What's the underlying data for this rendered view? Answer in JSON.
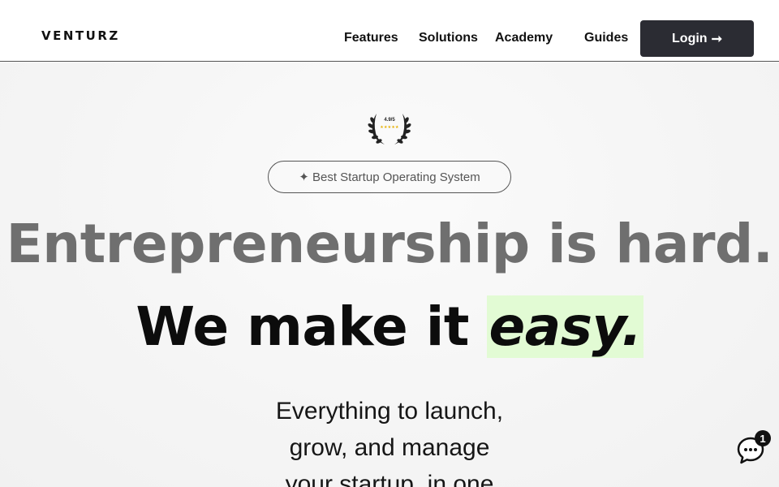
{
  "header": {
    "logo": "VENTURZ",
    "nav": [
      "Features",
      "Solutions",
      "Academy",
      "Guides"
    ],
    "login_label": "Login",
    "login_arrow": "➞"
  },
  "hero": {
    "rating": "4.9/5",
    "rating_stars": "★★★★★",
    "badge": "✦ Best Startup Operating System",
    "headline_line1": "Entrepreneurship is hard.",
    "headline_line2_prefix": "We make it ",
    "headline_line2_highlight": "easy",
    "headline_line2_suffix": ".",
    "subtext_lines": [
      "Everything to launch,",
      "grow, and manage",
      "your startup, in one"
    ]
  },
  "chat": {
    "icon": "chat-bubble-icon",
    "unread_count": "1"
  },
  "colors": {
    "highlight": "#e2fbd4",
    "button": "#2b2c33",
    "headline_muted": "#6f6f6f"
  }
}
